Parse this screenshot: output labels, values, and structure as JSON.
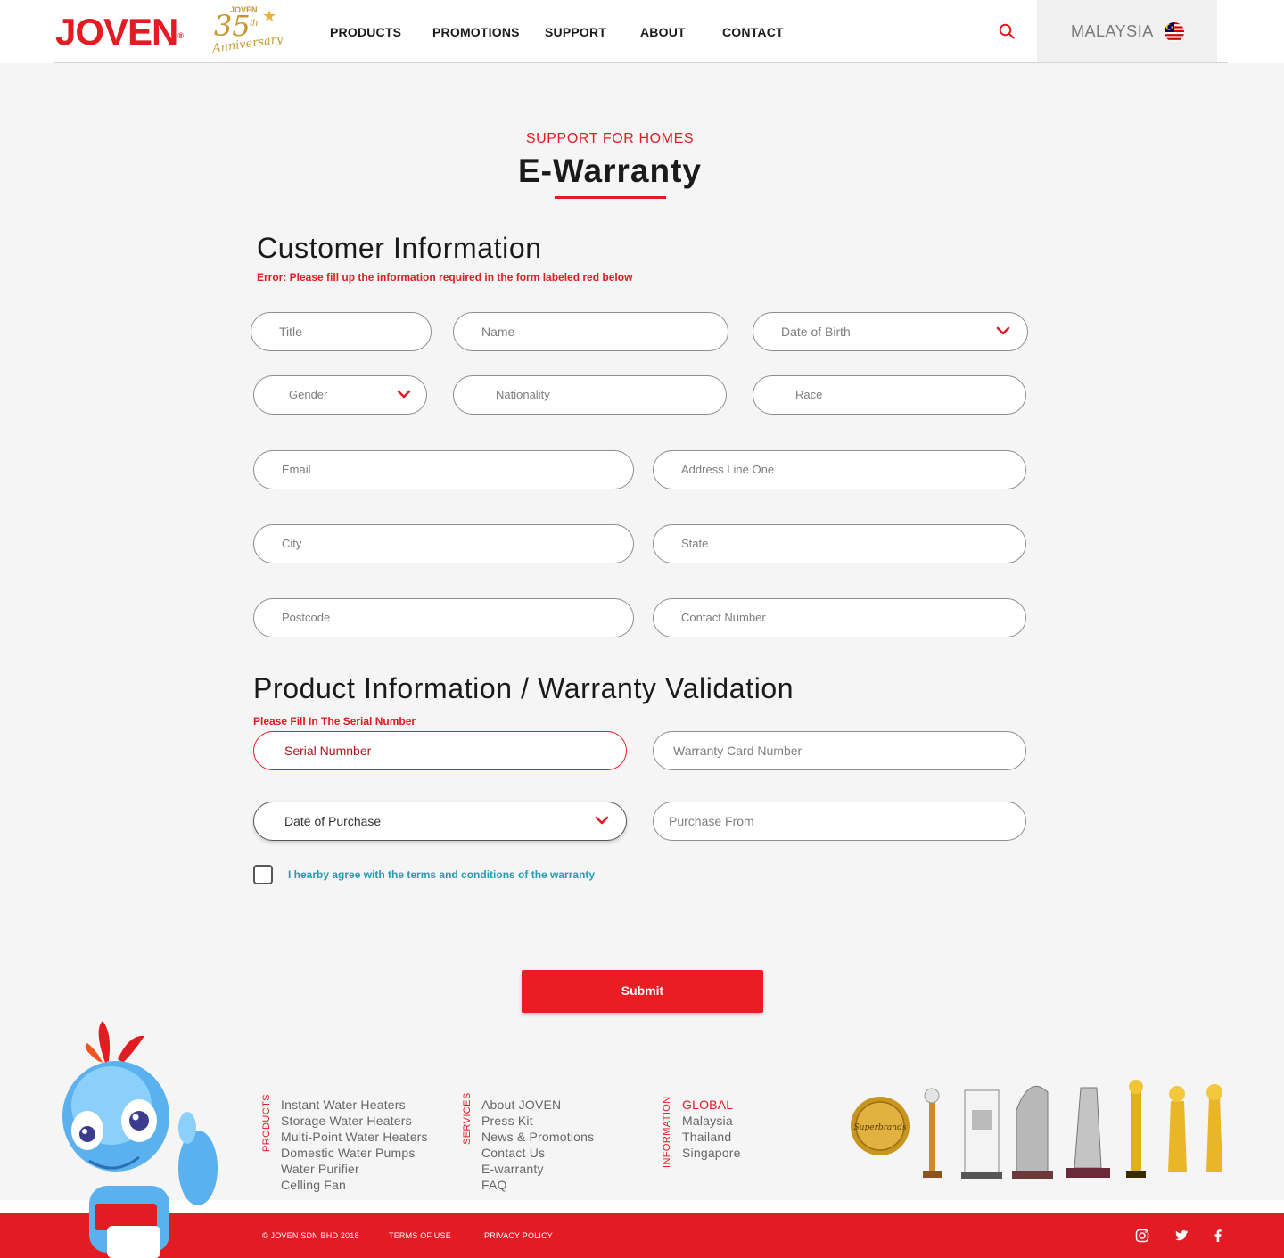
{
  "brand": {
    "logo": "JOVEN",
    "anniv_brand": "JOVEN",
    "anniv_number": "35",
    "anniv_suffix": "th",
    "anniv_word": "Anniversary"
  },
  "nav": {
    "items": [
      "PRODUCTS",
      "PROMOTIONS",
      "SUPPORT",
      "ABOUT",
      "CONTACT"
    ]
  },
  "country": {
    "label": "MALAYSIA"
  },
  "heading": {
    "eyebrow": "SUPPORT FOR HOMES",
    "title": "E-Warranty"
  },
  "customer": {
    "title": "Customer Information",
    "error": "Error: Please fill up the information required in the form labeled red below",
    "fields": {
      "title": "Title",
      "name": "Name",
      "dob": "Date of Birth",
      "gender": "Gender",
      "nationality": "Nationality",
      "race": "Race",
      "email": "Email",
      "address1": "Address Line One",
      "city": "City",
      "state": "State",
      "postcode": "Postcode",
      "contact": "Contact Number"
    }
  },
  "product": {
    "title": "Product Information  / Warranty Validation",
    "error": "Please Fill In The Serial Number",
    "fields": {
      "serial": "Serial Numnber",
      "warranty_card": "Warranty Card Number",
      "purchase_date": "Date of Purchase",
      "purchase_from": "Purchase From"
    },
    "agree": "I hearby agree with the terms and conditions of the warranty",
    "agree_checked": false
  },
  "submit": "Submit",
  "footer": {
    "products_label": "PRODUCTS",
    "products": [
      "Instant Water Heaters",
      "Storage Water Heaters",
      "Multi-Point Water Heaters",
      "Domestic Water Pumps",
      "Water Purifier",
      "Celling Fan"
    ],
    "services_label": "SERVICES",
    "services": [
      "About JOVEN",
      "Press Kit",
      "News & Promotions",
      "Contact Us",
      "E-warranty",
      "FAQ"
    ],
    "info_label": "INFORMATION",
    "info": [
      "GLOBAL",
      "Malaysia",
      "Thailand",
      "Singapore"
    ],
    "copyright": "© JOVEN SDN BHD 2018",
    "terms": "TERMS  OF USE",
    "privacy": "PRIVACY POLICY",
    "award_badge": "Superbrands"
  },
  "colors": {
    "brand_red": "#e31b23",
    "link_teal": "#2a9ab3",
    "gold": "#c9962d"
  },
  "icons": [
    "search-icon",
    "malaysia-flag-icon",
    "chevron-down-icon",
    "instagram-icon",
    "twitter-icon",
    "facebook-icon"
  ]
}
